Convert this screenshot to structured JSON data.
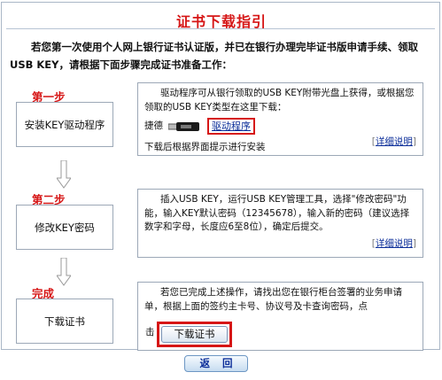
{
  "page": {
    "title": "证书下载指引",
    "intro": "若您第一次使用个人网上银行证书认证版，并已在银行办理完毕证书版申请手续、领取USB KEY，请根据下面步骤完成证书准备工作："
  },
  "steps": [
    {
      "label": "第一步",
      "box_text": "安装KEY驱动程序",
      "desc": "驱动程序可从银行领取的USB KEY附带光盘上获得，或根据您领取的USB KEY类型在这里下载：",
      "prefix": "捷德",
      "link_label": "驱动程序",
      "tail": "下载后根据界面提示进行安装",
      "detail_label": "详细说明"
    },
    {
      "label": "第二步",
      "box_text": "修改KEY密码",
      "desc": "插入USB KEY，运行USB KEY管理工具，选择\"修改密码\"功能，输入KEY默认密码（12345678），输入新的密码（建议选择数字和字母，长度应6至8位），确定后提交。",
      "detail_label": "详细说明"
    },
    {
      "label": "完成",
      "box_text": "下载证书",
      "desc": "若您已完成上述操作，请找出您在银行柜台签署的业务申请单，根据上面的签约主卡号、协议号及卡查询密码，点",
      "prefix": "击",
      "button_label": "下载证书"
    }
  ],
  "footer": {
    "back_label": "返回"
  },
  "colors": {
    "accent_red": "#d61616",
    "link_blue": "#0b2d99",
    "border_gray": "#9ca8b7"
  }
}
